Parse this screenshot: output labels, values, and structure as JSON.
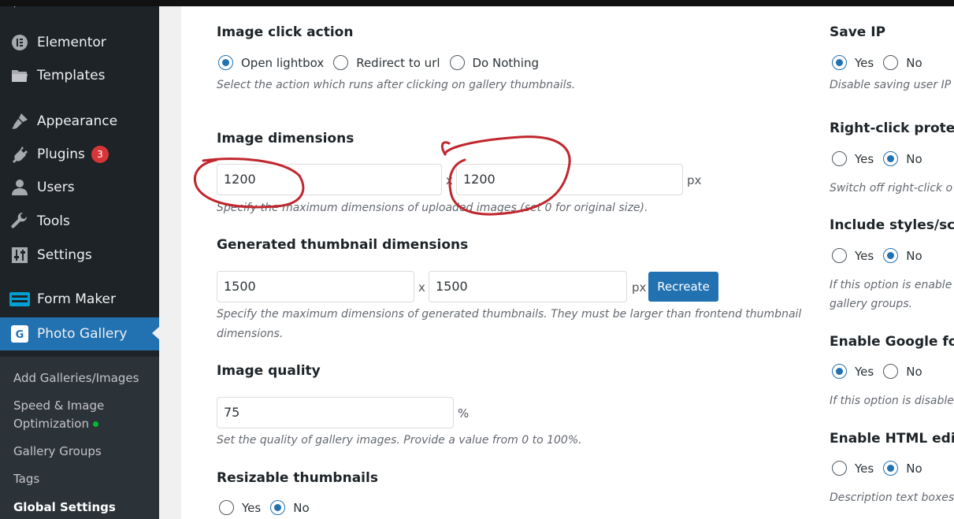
{
  "sidebar": {
    "items": [
      {
        "label": "Elementor",
        "icon": "elementor-icon"
      },
      {
        "label": "Templates",
        "icon": "folder-icon"
      },
      {
        "label": "Appearance",
        "icon": "paintbrush-icon"
      },
      {
        "label": "Plugins",
        "icon": "plug-icon",
        "badge": "3"
      },
      {
        "label": "Users",
        "icon": "user-icon"
      },
      {
        "label": "Tools",
        "icon": "wrench-icon"
      },
      {
        "label": "Settings",
        "icon": "settings-sliders-icon"
      },
      {
        "label": "Form Maker",
        "icon": "form-icon"
      },
      {
        "label": "Photo Gallery",
        "icon": "photo-gallery-icon"
      }
    ],
    "submenu": [
      {
        "label": "Add Galleries/Images"
      },
      {
        "label": "Speed & Image"
      },
      {
        "label": "Optimization"
      },
      {
        "label": "Gallery Groups"
      },
      {
        "label": "Tags"
      },
      {
        "label": "Global Settings"
      }
    ]
  },
  "left": {
    "click_action": {
      "title": "Image click action",
      "options": [
        "Open lightbox",
        "Redirect to url",
        "Do Nothing"
      ],
      "selected": 0,
      "desc": "Select the action which runs after clicking on gallery thumbnails."
    },
    "dimensions": {
      "title": "Image dimensions",
      "width": "1200",
      "height": "1200",
      "sep": "x",
      "unit": "px",
      "desc": "Specify the maximum dimensions of uploaded images (set 0 for original size)."
    },
    "thumb_dimensions": {
      "title": "Generated thumbnail dimensions",
      "width": "1500",
      "height": "1500",
      "sep": "x",
      "unit": "px",
      "button": "Recreate",
      "desc1": "Specify the maximum dimensions of generated thumbnails. They must be larger than frontend thumbnail",
      "desc2": "dimensions."
    },
    "quality": {
      "title": "Image quality",
      "value": "75",
      "unit": "%",
      "desc": "Set the quality of gallery images. Provide a value from 0 to 100%."
    },
    "resizable": {
      "title": "Resizable thumbnails",
      "yes": "Yes",
      "no": "No"
    }
  },
  "right": {
    "save_ip": {
      "title": "Save IP",
      "yes": "Yes",
      "no": "No",
      "desc": "Disable saving user IP"
    },
    "right_click": {
      "title": "Right-click protec",
      "yes": "Yes",
      "no": "No",
      "desc": "Switch off right-click o"
    },
    "include_styles": {
      "title": "Include styles/scri",
      "yes": "Yes",
      "no": "No",
      "desc1": "If this option is enable",
      "desc2": "gallery groups."
    },
    "google_fonts": {
      "title": "Enable Google for",
      "yes": "Yes",
      "no": "No",
      "desc": "If this option is disable"
    },
    "html_editor": {
      "title": "Enable HTML edit",
      "yes": "Yes",
      "no": "No",
      "desc": "Description text boxes"
    }
  },
  "colors": {
    "accent": "#2271b1",
    "sidebar": "#1d2327",
    "badge": "#d63638",
    "annotation": "#c0262d"
  }
}
